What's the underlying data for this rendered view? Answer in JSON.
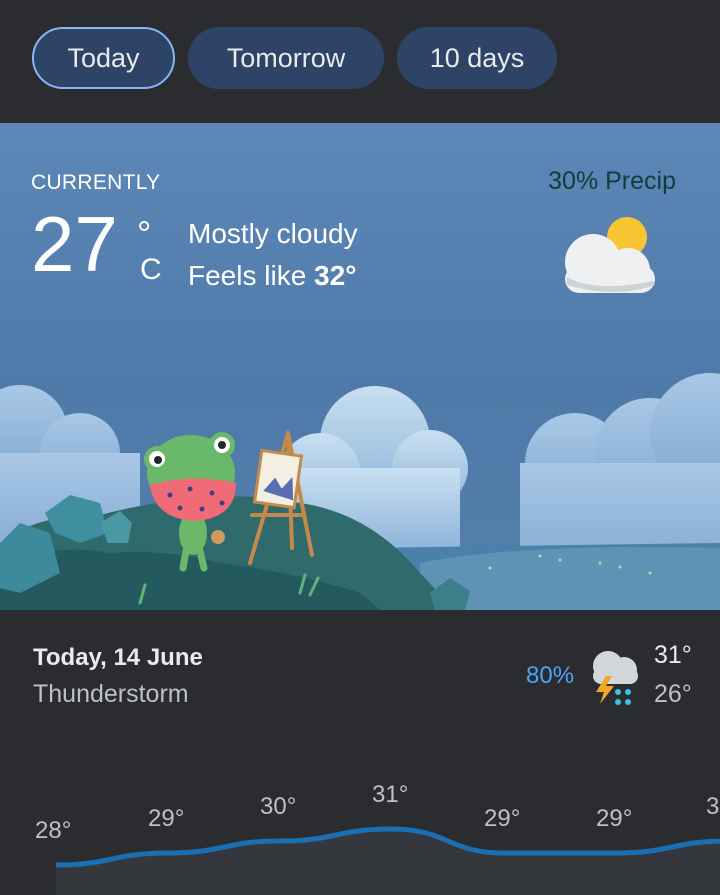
{
  "tabs": [
    {
      "label": "Today",
      "active": true
    },
    {
      "label": "Tomorrow",
      "active": false
    },
    {
      "label": "10 days",
      "active": false
    }
  ],
  "current": {
    "heading": "CURRENTLY",
    "temperature": "27",
    "degree_symbol": "°",
    "unit": "C",
    "condition": "Mostly cloudy",
    "feels_like_prefix": "Feels like ",
    "feels_like_value": "32°",
    "precip": "30% Precip",
    "icon": "partly-cloudy-icon"
  },
  "daily": {
    "date": "Today, 14 June",
    "condition": "Thunderstorm",
    "precip": "80%",
    "icon": "thunderstorm-icon",
    "high": "31°",
    "low": "26°"
  },
  "hourly": {
    "temps": [
      "28°",
      "29°",
      "30°",
      "31°",
      "29°",
      "29°",
      "3"
    ],
    "values": [
      28,
      29,
      30,
      31,
      29,
      29,
      30
    ],
    "line_color": "#1a6fb3"
  },
  "colors": {
    "accent": "#8ab4f8",
    "tab_bg": "#2e4466",
    "precip_blue": "#4fa3f7",
    "background": "#2b2c30"
  }
}
